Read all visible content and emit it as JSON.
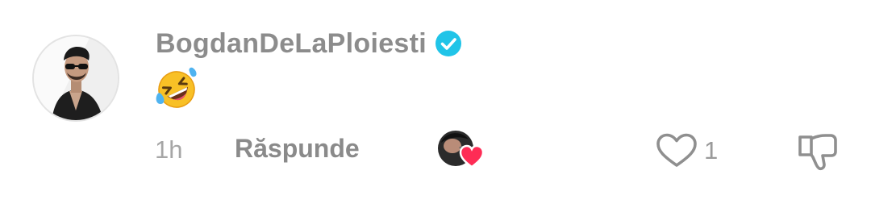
{
  "comment": {
    "author": {
      "username": "BogdanDeLaPloiesti",
      "verified": true,
      "avatar_icon": "user-avatar-photo"
    },
    "text": "🤣",
    "emoji_icon": "rolling-on-floor-laughing-emoji",
    "time_ago": "1h",
    "reply_label": "Răspunde",
    "creator_liked": true,
    "like_count": "1",
    "icons": {
      "verified": "verified-check-icon",
      "like": "heart-outline-icon",
      "dislike": "thumbs-down-icon",
      "creator_heart": "heart-filled-icon"
    },
    "colors": {
      "verified": "#20c4e8",
      "creator_heart": "#fe2c55",
      "username": "#8c8c8c",
      "meta": "#a6a6a6"
    }
  }
}
